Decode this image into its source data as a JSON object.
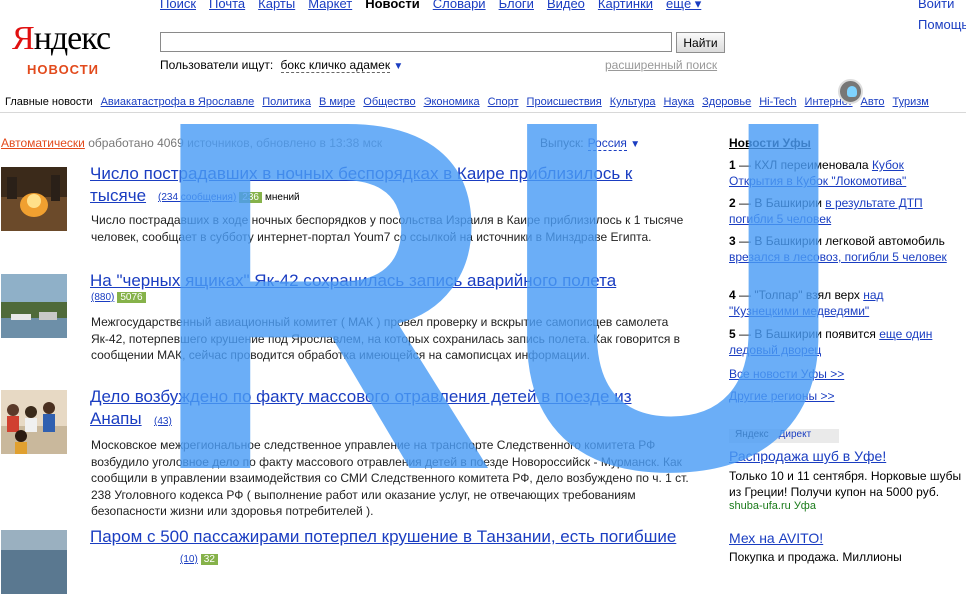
{
  "nav": {
    "links": [
      {
        "label": "Поиск"
      },
      {
        "label": "Почта"
      },
      {
        "label": "Карты"
      },
      {
        "label": "Маркет"
      },
      {
        "label": "Новости",
        "current": true
      },
      {
        "label": "Словари"
      },
      {
        "label": "Блоги"
      },
      {
        "label": "Видео"
      },
      {
        "label": "Картинки"
      },
      {
        "label": "ещё ▾"
      }
    ],
    "right_links": [
      "Войти",
      "Помощь"
    ]
  },
  "logo": {
    "first": "Я",
    "rest": "ндекс",
    "sub": "НОВОСТИ"
  },
  "search": {
    "value": "",
    "button": "Найти",
    "users_label": "Пользователи ищут:",
    "users_query": "бокс кличко адамек",
    "advanced": "расширенный поиск"
  },
  "categories": [
    {
      "label": "Главные новости",
      "current": true
    },
    {
      "label": "Авиакатастрофа в Ярославле"
    },
    {
      "label": "Политика"
    },
    {
      "label": "В мире"
    },
    {
      "label": "Общество"
    },
    {
      "label": "Экономика"
    },
    {
      "label": "Спорт"
    },
    {
      "label": "Происшествия"
    },
    {
      "label": "Культура"
    },
    {
      "label": "Наука"
    },
    {
      "label": "Здоровье"
    },
    {
      "label": "Hi-Tech"
    },
    {
      "label": "Интернет"
    },
    {
      "label": "Авто"
    },
    {
      "label": "Туризм"
    }
  ],
  "status": {
    "auto": "Автоматически",
    "text": " обработано 4069 источников, обновлено в 13:38 мск",
    "edition_label": "Выпуск:",
    "edition_value": "Россия"
  },
  "news": [
    {
      "title": "Число пострадавших в ночных беспорядках в Каире приблизилось к тысяче",
      "count": "(234 сообщения)",
      "opinions": "236",
      "opinions_label": "мнений",
      "text": "Число пострадавших в ходе ночных беспорядков у посольства Израиля в Каире приблизилось к 1 тысяче человек, сообщает в субботу интернет-портал Youm7 со ссылкой на источники в Минздраве Египта."
    },
    {
      "title": "На \"черных ящиках\" Як-42 сохранилась запись аварийного полета",
      "count": "(880)",
      "opinions": "5076",
      "text": "Межгосударственный авиационный комитет ( МАК ) провел проверку и вскрытие самописцев самолета Як-42, потерпевшего крушение под Ярославлем, на которых сохранилась запись полета. Как говорится в сообщении МАК, сейчас проводится обработка имеющейся на самописцах информации."
    },
    {
      "title": "Дело возбуждено по факту массового отравления детей в поезде из Анапы",
      "count": "(43)",
      "text": "Московское межрегиональное следственное управление на транспорте Следственного комитета РФ возбудило уголовное дело по факту массового отравления детей в поезде Новороссийск - Мурманск. Как сообщили в управлении взаимодействия со СМИ Следственного комитета РФ, дело возбуждено по ч. 1 ст. 238 Уголовного кодекса РФ ( выполнение работ или оказание услуг, не отвечающих требованиям безопасности жизни или здоровья потребителей )."
    },
    {
      "title": "Паром с 500 пассажирами потерпел крушение в Танзании, есть погибшие",
      "count": "(10)",
      "opinions": "32"
    }
  ],
  "ufa": {
    "title": "Новости Уфы",
    "items": [
      {
        "num": "1",
        "plain": "КХЛ переименовала ",
        "link": "Кубок Открытия в Кубок \"Локомотива\""
      },
      {
        "num": "2",
        "plain": "В Башкирии ",
        "link": "в результате ДТП погибли 5 человек"
      },
      {
        "num": "3",
        "plain": "В Башкирии легковой автомобиль ",
        "link": "врезался в лесовоз, погибли 5 человек"
      },
      {
        "num": "4",
        "plain": "\"Толпар\" взял верх ",
        "link": "над \"Кузнецкими медведями\""
      },
      {
        "num": "5",
        "plain": "В Башкирии появится ",
        "link": "еще один ледовый дворец"
      }
    ],
    "all_link": "Все новости Уфы  >>",
    "regions_link": "Другие регионы  >>"
  },
  "direct": {
    "yandex": "Яндекс",
    "direct": "Директ"
  },
  "ads": [
    {
      "title": "Распродажа шуб в Уфе!",
      "text": "Только 10 и 11 сентября. Норковые шубы из Греции! Получи купон на 5000 руб.",
      "url": "shuba-ufa.ru Уфа"
    },
    {
      "title": "Мех на AVITO!",
      "text": "Покупка и продажа. Миллионы"
    }
  ],
  "watermark": {
    "text": "RU",
    "color": "#4a9cf5"
  }
}
